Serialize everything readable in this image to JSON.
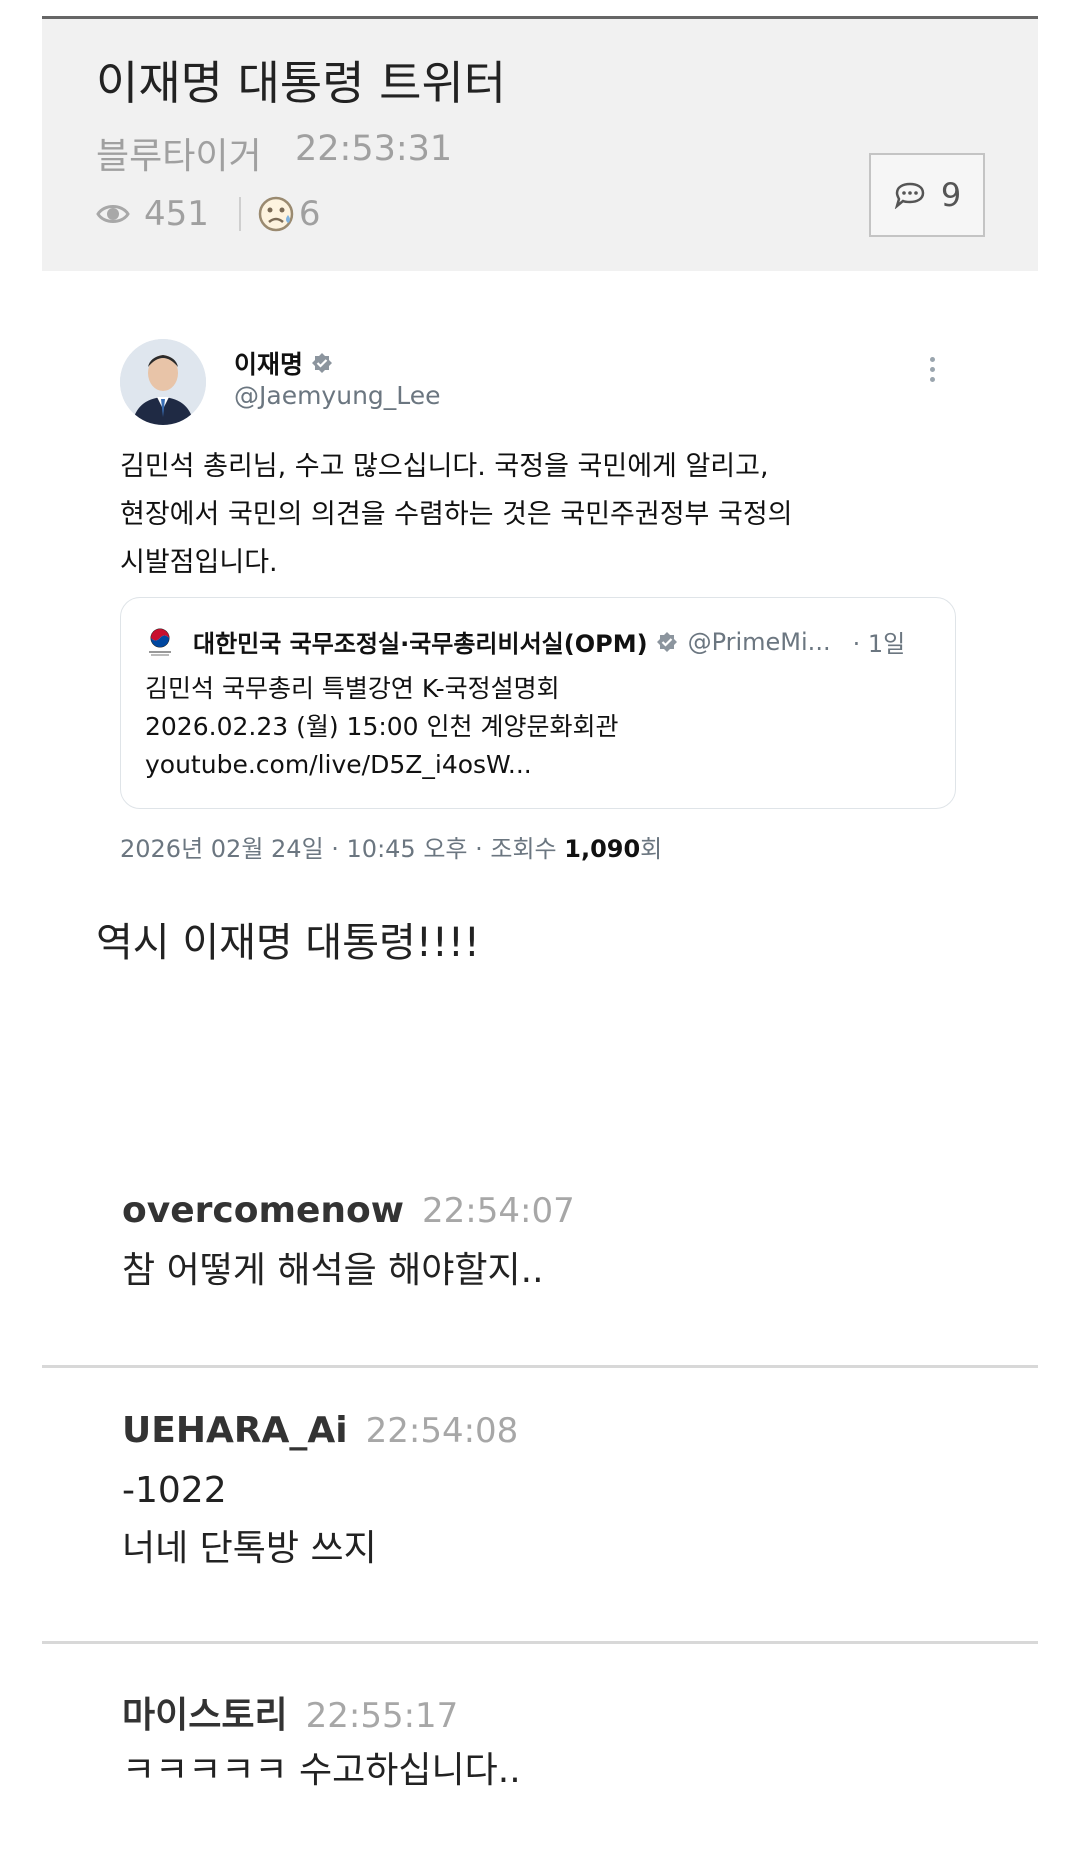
{
  "post": {
    "title": "이재명 대통령 트위터",
    "author": "블루타이거",
    "time": "22:53:31",
    "views": "451",
    "reactions": "6",
    "comment_count": "9",
    "body": "역시 이재명 대통령!!!!"
  },
  "tweet": {
    "name": "이재명",
    "handle": "@Jaemyung_Lee",
    "text_lines": [
      "김민석 총리님, 수고 많으십니다. 국정을 국민에게 알리고,",
      "현장에서 국민의 의견을 수렴하는 것은 국민주권정부 국정의",
      "시발점입니다."
    ],
    "quote": {
      "name": "대한민국 국무조정실·국무총리비서실(OPM)",
      "handle": "@PrimeMi...",
      "age": "· 1일",
      "lines": [
        "김민석 국무총리 특별강연 K-국정설명회",
        "2026.02.23 (월) 15:00 인천 계양문화회관",
        "youtube.com/live/D5Z_i4osW..."
      ]
    },
    "date": "2026년 02월 24일 · 10:45 오후 · 조회수 ",
    "view_count": "1,090",
    "view_unit": "회"
  },
  "comments": [
    {
      "user": "overcomenow",
      "time": "22:54:07",
      "lines": [
        "참 어떻게 해석을 해야할지.."
      ]
    },
    {
      "user": "UEHARA_Ai",
      "time": "22:54:08",
      "lines": [
        "-1022",
        "너네 단톡방 쓰지"
      ]
    },
    {
      "user": "마이스토리",
      "time": "22:55:17",
      "lines": [
        "ㅋㅋㅋㅋㅋ 수고하십니다.."
      ]
    }
  ],
  "icons": {
    "views": "eye-icon",
    "reactions": "sad-face-icon",
    "comments": "speech-bubble-icon",
    "verified": "verified-badge-icon",
    "more": "more-vertical-icon",
    "gov": "government-emblem-icon"
  }
}
